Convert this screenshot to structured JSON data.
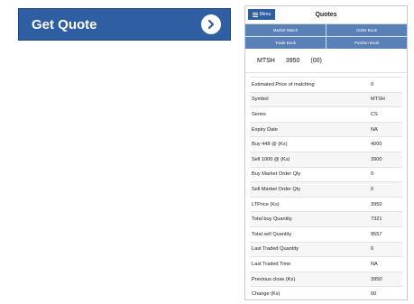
{
  "left_button": {
    "label": "Get Quote",
    "icon": "chevron-right-icon",
    "color": "#2f5ea3"
  },
  "app": {
    "menu_label": "Menu",
    "title": "Quotes",
    "nav": [
      "Market Watch",
      "Order Book",
      "Trade Book",
      "Position Book"
    ]
  },
  "summary": {
    "symbol": "MTSH",
    "price": "3950",
    "change": "(00)"
  },
  "details": [
    {
      "label": "Estimated Price of matching",
      "value": "0"
    },
    {
      "label": "Symbol",
      "value": "MTSH"
    },
    {
      "label": "Series",
      "value": "CS"
    },
    {
      "label": "Expiry Date",
      "value": "NA"
    },
    {
      "label": "Buy 448 @ (Ks)",
      "value": "4000"
    },
    {
      "label": "Sell 1000 @ (Ks)",
      "value": "3900"
    },
    {
      "label": "Buy Market Order Qty",
      "value": "0"
    },
    {
      "label": "Sell Market Order Qty",
      "value": "0"
    },
    {
      "label": "LTPrice (Ks)",
      "value": "3950"
    },
    {
      "label": "Total buy Quantity",
      "value": "7321"
    },
    {
      "label": "Total sell Quantity",
      "value": "9557"
    },
    {
      "label": "Last Traded Quantity",
      "value": "0"
    },
    {
      "label": "Last Traded Time",
      "value": "NA"
    },
    {
      "label": "Previous close (Ks)",
      "value": "3950"
    },
    {
      "label": "Change (Ks)",
      "value": "00"
    }
  ]
}
